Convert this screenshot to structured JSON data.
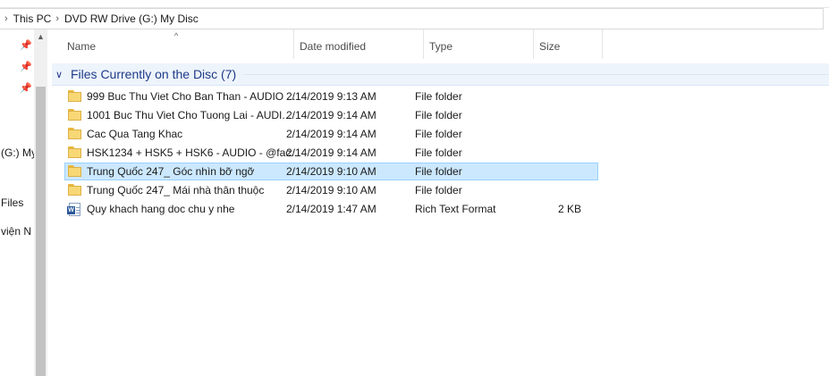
{
  "address": {
    "crumbs": [
      "This PC",
      "DVD RW Drive (G:) My Disc"
    ]
  },
  "nav": {
    "partial_labels": [
      "(G:) My",
      "Files",
      "viện N"
    ]
  },
  "columns": {
    "name": "Name",
    "date": "Date modified",
    "type": "Type",
    "size": "Size"
  },
  "group": {
    "title": "Files Currently on the Disc (7)"
  },
  "files": [
    {
      "name": "999 Buc Thu Viet Cho Ban Than - AUDIO ...",
      "date": "2/14/2019 9:13 AM",
      "type": "File folder",
      "size": "",
      "icon": "folder-icon"
    },
    {
      "name": "1001 Buc Thu Viet Cho Tuong Lai - AUDI...",
      "date": "2/14/2019 9:14 AM",
      "type": "File folder",
      "size": "",
      "icon": "folder-icon"
    },
    {
      "name": "Cac Qua Tang Khac",
      "date": "2/14/2019 9:14 AM",
      "type": "File folder",
      "size": "",
      "icon": "folder-icon"
    },
    {
      "name": "HSK1234 + HSK5 + HSK6 - AUDIO - @fac...",
      "date": "2/14/2019 9:14 AM",
      "type": "File folder",
      "size": "",
      "icon": "folder-icon"
    },
    {
      "name": "Trung Quốc 247_ Góc nhìn bỡ ngỡ",
      "date": "2/14/2019 9:10 AM",
      "type": "File folder",
      "size": "",
      "icon": "folder-icon",
      "selected": true
    },
    {
      "name": "Trung Quốc 247_ Mái nhà thân thuộc",
      "date": "2/14/2019 9:10 AM",
      "type": "File folder",
      "size": "",
      "icon": "folder-icon"
    },
    {
      "name": "Quy khach hang doc chu y nhe",
      "date": "2/14/2019 1:47 AM",
      "type": "Rich Text Format",
      "size": "2 KB",
      "icon": "word-document-icon"
    }
  ],
  "colors": {
    "group_title": "#1e3a8a",
    "selection_bg": "#cce8ff",
    "selection_border": "#99d1ff",
    "folder": "#f8d775"
  }
}
